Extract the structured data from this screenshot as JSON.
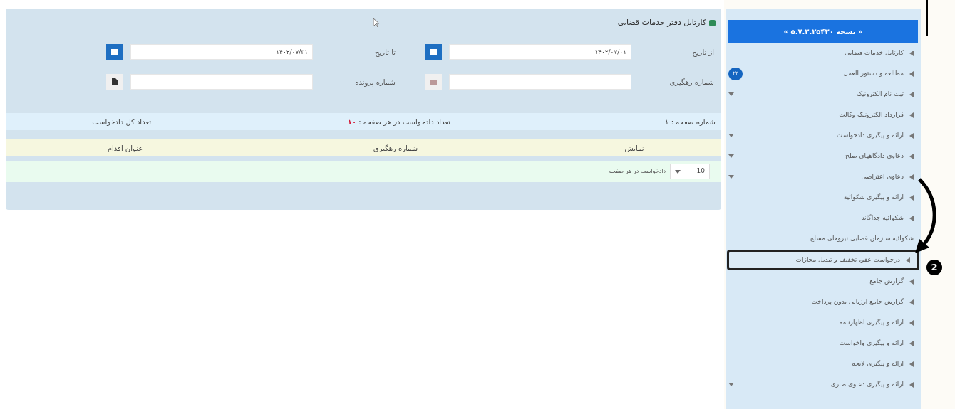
{
  "panel": {
    "title": "کارتابل دفتر خدمات قضایی",
    "fields": [
      {
        "label": "از تاریخ",
        "value": "۱۴۰۲/۰۷/۰۱",
        "kind": "date"
      },
      {
        "label": "تا تاریخ",
        "value": "۱۴۰۲/۰۷/۳۱",
        "kind": "date"
      },
      {
        "label": "شماره رهگیری",
        "kind": "tracking"
      },
      {
        "label": "شماره پرونده",
        "kind": "file"
      }
    ],
    "info": {
      "page": "شماره صفحه : ۱",
      "per_page_label": "تعداد دادخواست در هر صفحه :",
      "per_page": "۱۰",
      "total": "تعداد کل دادخواست"
    },
    "table": {
      "columns": [
        "نمایش",
        "شماره رهگیری",
        "عنوان اقدام"
      ]
    },
    "pager": {
      "size": "10",
      "label": "دادخواست در هر صفحه"
    }
  },
  "sidebar": {
    "version": "« نسخه ۵.۷.۲.۲۵۴۲۰ »",
    "items": [
      {
        "label": "کارتابل خدمات قضایی",
        "arrow": true,
        "expandable": false,
        "selected": false
      },
      {
        "label": "مطالعه و دستور العمل",
        "arrow": true,
        "expandable": false,
        "selected": false,
        "badge": "۲۲"
      },
      {
        "label": "ثبت نام الکترونیک",
        "arrow": true,
        "expandable": true,
        "selected": false
      },
      {
        "label": "قرارداد الکترونیک وکالت",
        "arrow": true,
        "expandable": false,
        "selected": false
      },
      {
        "label": "ارائه و پیگیری دادخواست",
        "arrow": true,
        "expandable": true,
        "selected": false
      },
      {
        "label": "دعاوی دادگاههای صلح",
        "arrow": true,
        "expandable": true,
        "selected": false
      },
      {
        "label": "دعاوی اعتراضی",
        "arrow": true,
        "expandable": true,
        "selected": false
      },
      {
        "label": "ارائه و پیگیری شکوائیه",
        "arrow": true,
        "expandable": false,
        "selected": false
      },
      {
        "label": "شکوائیه جداگانه",
        "arrow": true,
        "expandable": false,
        "selected": false
      },
      {
        "label": "شکوائیه سازمان قضایی نیروهای مسلح",
        "arrow": false,
        "expandable": false,
        "selected": false
      },
      {
        "label": "درخواست عفو، تخفیف و تبدیل مجازات",
        "arrow": true,
        "expandable": false,
        "selected": true
      },
      {
        "label": "گزارش جامع",
        "arrow": true,
        "expandable": false,
        "selected": false
      },
      {
        "label": "گزارش جامع ارزیابی بدون پرداخت",
        "arrow": true,
        "expandable": false,
        "selected": false
      },
      {
        "label": "ارائه و پیگیری اظهارنامه",
        "arrow": true,
        "expandable": false,
        "selected": false
      },
      {
        "label": "ارائه و پیگیری واخواست",
        "arrow": true,
        "expandable": false,
        "selected": false
      },
      {
        "label": "ارائه و پیگیری لایحه",
        "arrow": true,
        "expandable": false,
        "selected": false
      },
      {
        "label": "ارائه و پیگیری دعاوی طاری",
        "arrow": true,
        "expandable": true,
        "selected": false
      }
    ]
  },
  "annotation": {
    "step": "2"
  }
}
